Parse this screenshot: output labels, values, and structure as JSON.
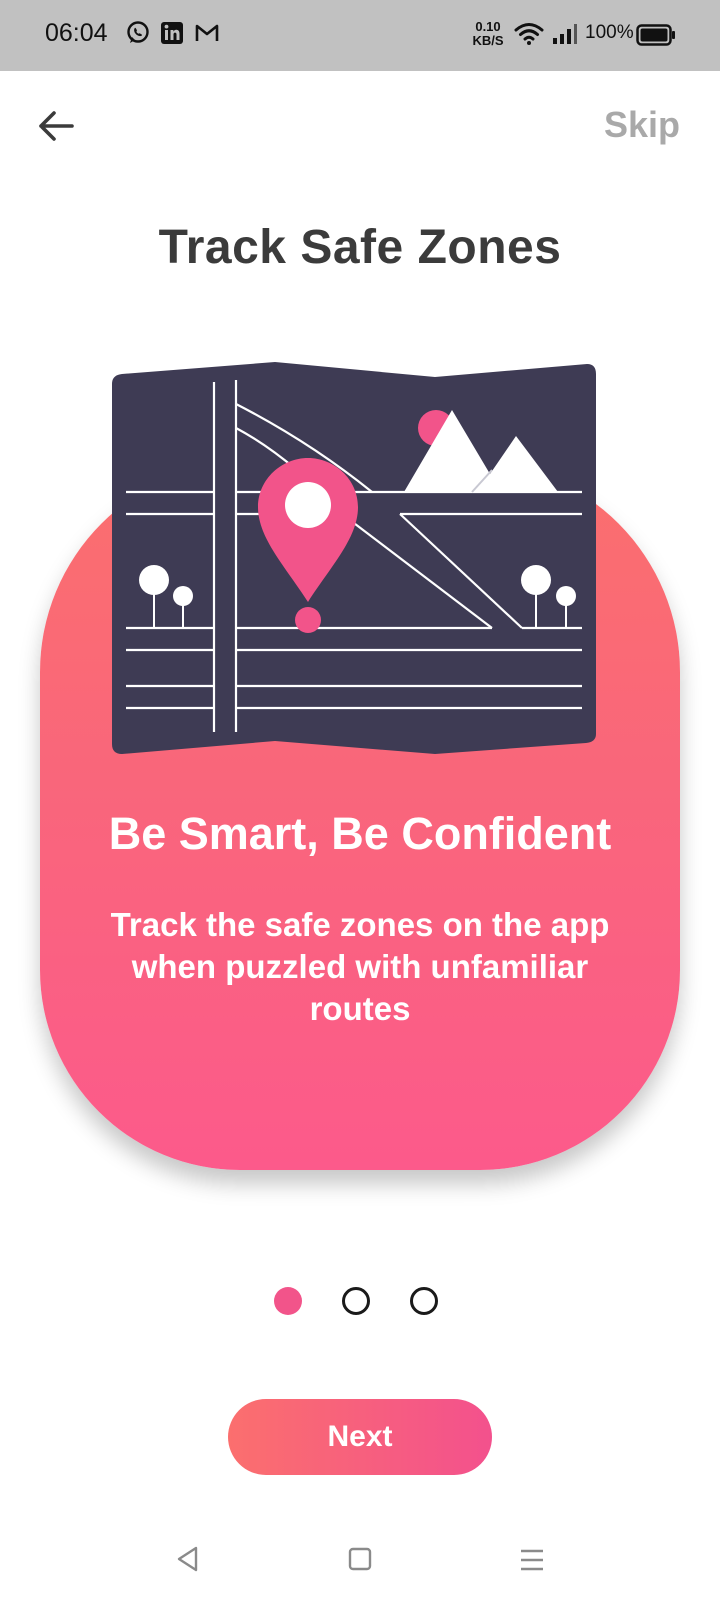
{
  "status_bar": {
    "time": "06:04",
    "net_speed_value": "0.10",
    "net_speed_unit": "KB/S",
    "battery_percent": "100%",
    "left_icons": [
      "whatsapp-icon",
      "linkedin-icon",
      "gmail-icon"
    ]
  },
  "header": {
    "back_icon": "arrow-left-icon",
    "skip_label": "Skip"
  },
  "page": {
    "title": "Track Safe Zones"
  },
  "card": {
    "illustration": "map-with-location-pin",
    "heading": "Be Smart, Be Confident",
    "body": "Track the safe zones on the app when puzzled with unfamiliar routes"
  },
  "pagination": {
    "total": 3,
    "active_index": 0
  },
  "actions": {
    "next_label": "Next"
  },
  "colors": {
    "accent_pink": "#f2548a",
    "accent_coral": "#fb6f6e",
    "map_dark": "#3e3b54",
    "title_text": "#3b3b3b",
    "skip_text": "#a9a9a9"
  },
  "nav_bar": {
    "icons": [
      "back-triangle-icon",
      "home-square-icon",
      "menu-lines-icon"
    ]
  }
}
